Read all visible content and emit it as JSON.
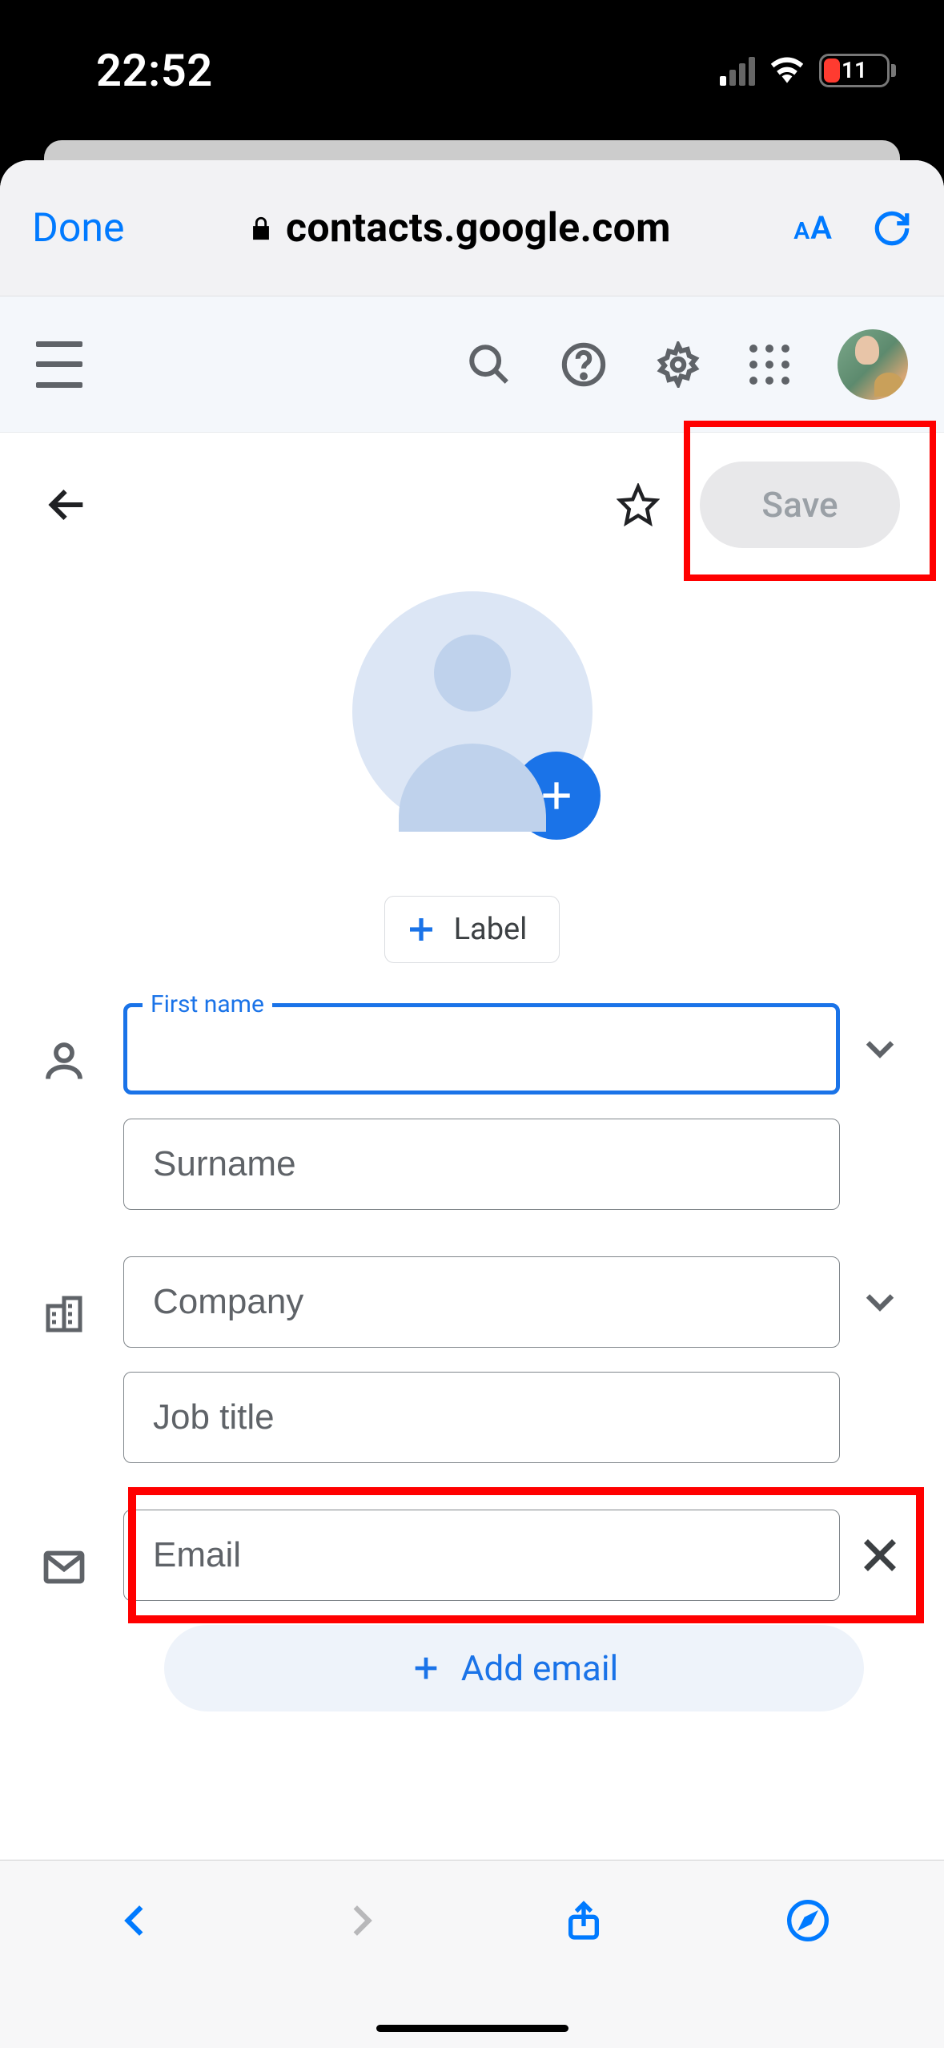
{
  "status": {
    "time": "22:52",
    "battery_pct": "11"
  },
  "browser": {
    "done": "Done",
    "url": "contacts.google.com"
  },
  "actions": {
    "save": "Save"
  },
  "label_chip": "Label",
  "fields": {
    "first_name_label": "First name",
    "first_name_value": "",
    "surname_placeholder": "Surname",
    "company_placeholder": "Company",
    "job_title_placeholder": "Job title",
    "email_placeholder": "Email"
  },
  "add_email": "Add email"
}
